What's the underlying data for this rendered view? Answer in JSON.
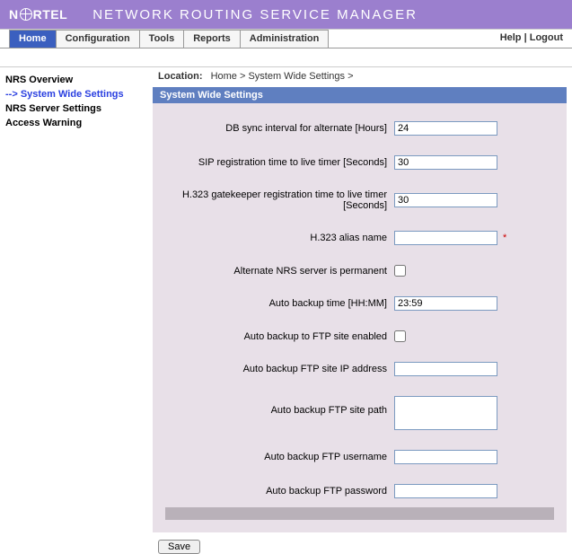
{
  "brand": {
    "name_pre": "N",
    "name_post": "RTEL"
  },
  "app_title": "NETWORK ROUTING SERVICE MANAGER",
  "tabs": {
    "home": "Home",
    "configuration": "Configuration",
    "tools": "Tools",
    "reports": "Reports",
    "administration": "Administration"
  },
  "header_links": {
    "help": "Help",
    "logout": "Logout",
    "sep": " | "
  },
  "sidebar": {
    "overview": "NRS Overview",
    "system_wide": "System Wide Settings",
    "server_settings": "NRS Server Settings",
    "access_warning": "Access Warning"
  },
  "breadcrumb": {
    "label": "Location:",
    "home": "Home",
    "sep": " > ",
    "current": "System Wide Settings",
    "trail": " > "
  },
  "section_title": "System Wide Settings",
  "form": {
    "db_sync": {
      "label": "DB sync interval for alternate [Hours]",
      "value": "24"
    },
    "sip_ttl": {
      "label": "SIP registration time to live timer [Seconds]",
      "value": "30"
    },
    "h323_ttl": {
      "label": "H.323 gatekeeper registration time to live timer [Seconds]",
      "value": "30"
    },
    "h323_alias": {
      "label": "H.323 alias name",
      "value": "",
      "required": "*"
    },
    "alt_permanent": {
      "label": "Alternate NRS server is permanent"
    },
    "auto_backup_time": {
      "label": "Auto backup time [HH:MM]",
      "value": "23:59"
    },
    "ftp_enabled": {
      "label": "Auto backup to FTP site enabled"
    },
    "ftp_ip": {
      "label": "Auto backup FTP site IP address",
      "value": ""
    },
    "ftp_path": {
      "label": "Auto backup FTP site path",
      "value": ""
    },
    "ftp_user": {
      "label": "Auto backup FTP username",
      "value": ""
    },
    "ftp_pass": {
      "label": "Auto backup FTP password",
      "value": ""
    }
  },
  "save_label": "Save"
}
